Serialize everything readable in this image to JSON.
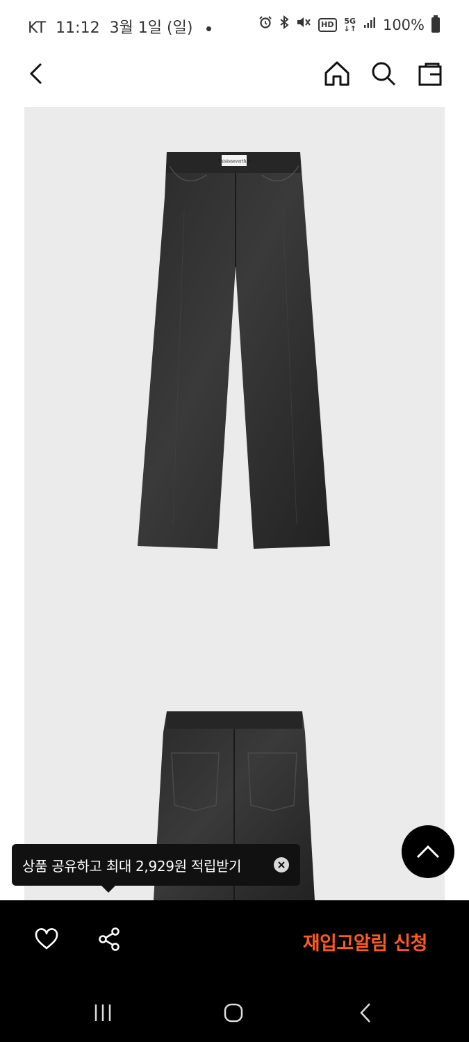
{
  "status_bar": {
    "carrier": "KT",
    "time": "11:12",
    "date": "3월 1일 (일)",
    "network": "5G",
    "hd_label": "HD",
    "battery": "100%",
    "icons": [
      "alarm-icon",
      "bluetooth-icon",
      "mute-icon",
      "hd-icon",
      "5g-icon",
      "signal-icon",
      "battery-icon"
    ]
  },
  "header": {
    "icons": [
      "back-icon",
      "home-icon",
      "search-icon",
      "shopping-bag-icon"
    ]
  },
  "gallery": {
    "background": "#ebebeb",
    "label_text": "Thisisneverthat",
    "images": [
      "jeans-front-image",
      "jeans-back-image"
    ]
  },
  "tooltip": {
    "text": "상품 공유하고 최대 2,929원 적립받기"
  },
  "action_bar": {
    "restock_label": "재입고알림 신청",
    "accent_color": "#ff5a1f"
  },
  "nav_bar": {
    "icons": [
      "recent-apps-icon",
      "home-circle-icon",
      "nav-back-icon"
    ]
  }
}
